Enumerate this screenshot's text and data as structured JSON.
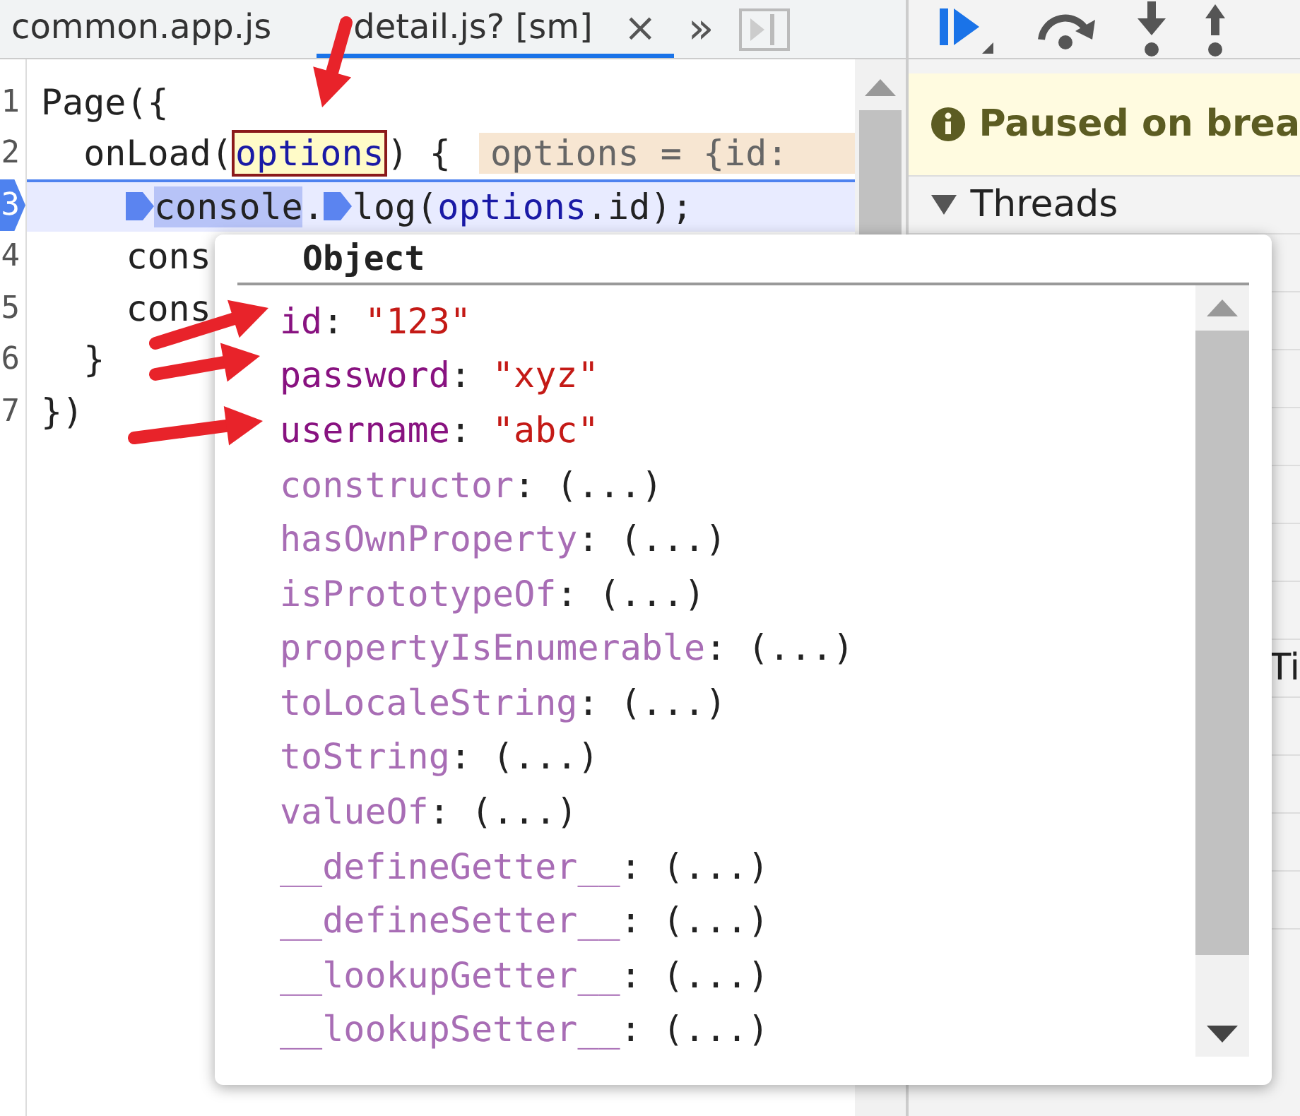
{
  "tabs": [
    {
      "label": "common.app.js",
      "selected": false,
      "closable": false
    },
    {
      "label": "detail.js? [sm]",
      "selected": true,
      "closable": true
    }
  ],
  "close_glyph": "×",
  "more_tabs": "»",
  "code_lines": [
    {
      "number": "1",
      "current": false,
      "segments": [
        {
          "kind": "plain",
          "text": "Page({"
        }
      ]
    },
    {
      "number": "2",
      "current": false,
      "segments": [
        {
          "kind": "plain",
          "text": "  onLoad("
        },
        {
          "kind": "hovered",
          "text": "options"
        },
        {
          "kind": "plain",
          "text": ") {"
        },
        {
          "kind": "inline_value",
          "text": "options = {id:"
        }
      ]
    },
    {
      "number": "3",
      "current": true,
      "segments": [
        {
          "kind": "breakpoint"
        },
        {
          "kind": "selected",
          "text": "console"
        },
        {
          "kind": "plain",
          "text": "."
        },
        {
          "kind": "breakpoint"
        },
        {
          "kind": "plain",
          "text": "log("
        },
        {
          "kind": "ident",
          "text": "options"
        },
        {
          "kind": "plain",
          "text": ".id);"
        }
      ]
    },
    {
      "number": "4",
      "current": false,
      "segments": [
        {
          "kind": "plain",
          "text": "    cons"
        }
      ]
    },
    {
      "number": "5",
      "current": false,
      "segments": [
        {
          "kind": "plain",
          "text": "    cons"
        }
      ]
    },
    {
      "number": "6",
      "current": false,
      "segments": [
        {
          "kind": "plain",
          "text": "  }"
        }
      ]
    },
    {
      "number": "7",
      "current": false,
      "segments": [
        {
          "kind": "plain",
          "text": "})"
        }
      ]
    }
  ],
  "status_banner": {
    "text": "Paused on brea"
  },
  "sections": [
    {
      "label": "Threads",
      "expanded": true
    }
  ],
  "side_rows": [
    "",
    "",
    "",
    "",
    "",
    "",
    "",
    "Ti",
    "",
    "",
    "",
    ""
  ],
  "popover": {
    "title": "Object",
    "separator": ":",
    "properties": [
      {
        "kind": "own",
        "key": "id",
        "value": "\"123\""
      },
      {
        "kind": "own",
        "key": "password",
        "value": "\"xyz\""
      },
      {
        "kind": "own",
        "key": "username",
        "value": "\"abc\""
      },
      {
        "kind": "proto",
        "key": "constructor",
        "value": "(...)"
      },
      {
        "kind": "proto",
        "key": "hasOwnProperty",
        "value": "(...)"
      },
      {
        "kind": "proto",
        "key": "isPrototypeOf",
        "value": "(...)"
      },
      {
        "kind": "proto",
        "key": "propertyIsEnumerable",
        "value": "(...)"
      },
      {
        "kind": "proto",
        "key": "toLocaleString",
        "value": "(...)"
      },
      {
        "kind": "proto",
        "key": "toString",
        "value": "(...)"
      },
      {
        "kind": "proto",
        "key": "valueOf",
        "value": "(...)"
      },
      {
        "kind": "proto",
        "key": "__defineGetter__",
        "value": "(...)"
      },
      {
        "kind": "proto",
        "key": "__defineSetter__",
        "value": "(...)"
      },
      {
        "kind": "proto",
        "key": "__lookupGetter__",
        "value": "(...)"
      },
      {
        "kind": "proto",
        "key": "__lookupSetter__",
        "value": "(...)"
      }
    ]
  }
}
